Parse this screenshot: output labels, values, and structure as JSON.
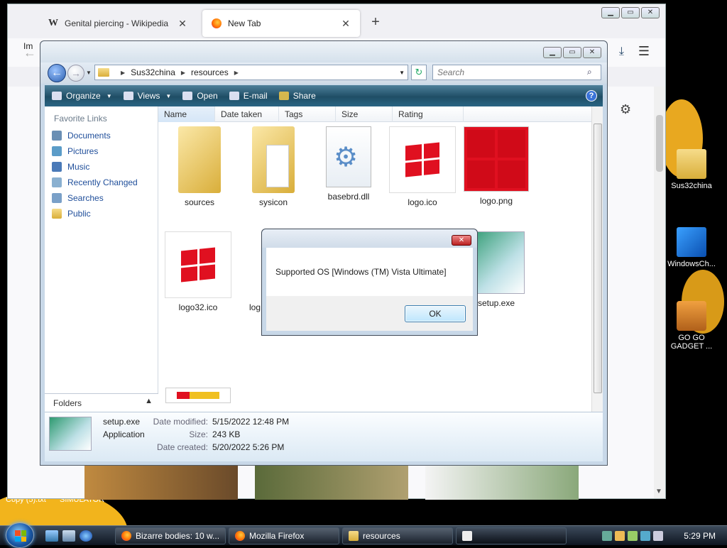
{
  "firefox": {
    "tabs": [
      {
        "label": "Genital piercing - Wikipedia",
        "favicon": "W"
      },
      {
        "label": "New Tab"
      }
    ],
    "import_label": "Im"
  },
  "explorer": {
    "breadcrumb": [
      "Sus32china",
      "resources"
    ],
    "search_placeholder": "Search",
    "commands": [
      "Organize",
      "Views",
      "Open",
      "E-mail",
      "Share"
    ],
    "favorite_links_title": "Favorite Links",
    "links": [
      "Documents",
      "Pictures",
      "Music",
      "Recently Changed",
      "Searches",
      "Public"
    ],
    "folders_label": "Folders",
    "columns": [
      "Name",
      "Date taken",
      "Tags",
      "Size",
      "Rating"
    ],
    "files": [
      "sources",
      "sysicon",
      "basebrd.dll",
      "logo.ico",
      "logo.png",
      "logo32.ico",
      "log",
      "setup.exe"
    ],
    "details": {
      "name": "setup.exe",
      "type": "Application",
      "modified_label": "Date modified:",
      "modified": "5/15/2022 12:48 PM",
      "size_label": "Size:",
      "size": "243 KB",
      "created_label": "Date created:",
      "created": "5/20/2022 5:26 PM"
    }
  },
  "dialog": {
    "message": "Supported OS [Windows (TM) Vista Ultimate]",
    "ok": "OK"
  },
  "desktop": {
    "icons": [
      {
        "label": "Sus32china"
      },
      {
        "label": "WindowsCh..."
      },
      {
        "label": "GO GO GADGET ..."
      }
    ],
    "files_bottom": [
      "Copy (5).txt",
      "SIMULATOR"
    ]
  },
  "taskbar": {
    "buttons": [
      "Bizarre bodies: 10 w...",
      "Mozilla Firefox",
      "resources"
    ],
    "clock": "5:29 PM"
  },
  "colors": {
    "accent": "#1f4e9a",
    "command_bar": "#1f4e66",
    "logo_red": "#e01020"
  }
}
